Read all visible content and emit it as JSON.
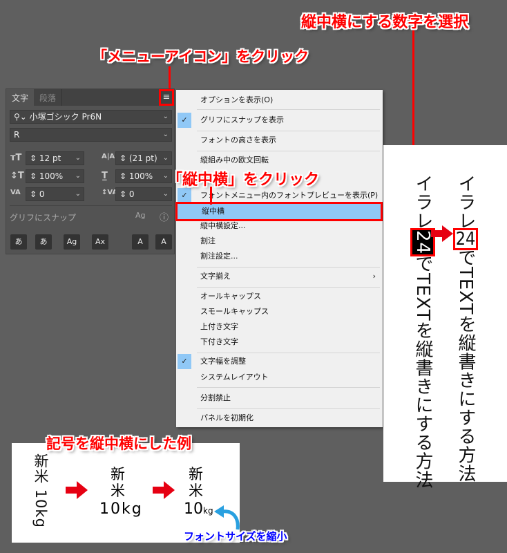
{
  "callouts": {
    "select_number": "縦中横にする数字を選択",
    "click_menu_icon": "「メニューアイコン」をクリック",
    "click_tcy": "「縦中横」をクリック",
    "example_title": "記号を縦中横にした例",
    "shrink_font": "フォントサイズを縮小"
  },
  "panel": {
    "tabs": [
      "文字",
      "段落"
    ],
    "font_family": "小塚ゴシック Pr6N",
    "font_style": "R",
    "font_size": "12 pt",
    "leading": "(21 pt)",
    "vertical_scale": "100%",
    "horizontal_scale": "100%",
    "kerning": "0",
    "tracking": "0",
    "snap_label": "グリフにスナップ",
    "search_icon": "search-icon",
    "menu_icon": "≡",
    "buttons": [
      "あ",
      "あ",
      "Ag",
      "Ax",
      "A",
      "A"
    ]
  },
  "menu": {
    "items": [
      {
        "label": "オプションを表示(O)",
        "checked": false
      },
      {
        "label": "グリフにスナップを表示",
        "checked": true
      },
      {
        "label": "フォントの高さを表示",
        "checked": false
      },
      {
        "label": "縦組み中の欧文回転",
        "checked": false
      },
      {
        "label": "フォントメニュー内のフォントプレビューを表示(P)",
        "checked": true
      },
      {
        "label": "縦中横",
        "checked": false
      },
      {
        "label": "縦中横設定...",
        "checked": false
      },
      {
        "label": "割注",
        "checked": false
      },
      {
        "label": "割注設定...",
        "checked": false
      },
      {
        "label": "文字揃え",
        "checked": false
      },
      {
        "label": "オールキャップス",
        "checked": false
      },
      {
        "label": "スモールキャップス",
        "checked": false
      },
      {
        "label": "上付き文字",
        "checked": false
      },
      {
        "label": "下付き文字",
        "checked": false
      },
      {
        "label": "文字幅を調整",
        "checked": true
      },
      {
        "label": "システムレイアウト",
        "checked": false
      },
      {
        "label": "分割禁止",
        "checked": false
      },
      {
        "label": "パネルを初期化",
        "checked": false
      }
    ]
  },
  "vertical_sample": {
    "pre": "イラレ",
    "num": "24",
    "post": "でTEXTを縦書きにする方法"
  },
  "example": {
    "s1": "新米",
    "s1b": "10kg",
    "s2a": "新",
    "s2b": "米",
    "num": "10",
    "unit": "kg"
  },
  "colors": {
    "accent": "#ff0000",
    "highlight": "#90c8f6",
    "note": "#0000ff"
  }
}
